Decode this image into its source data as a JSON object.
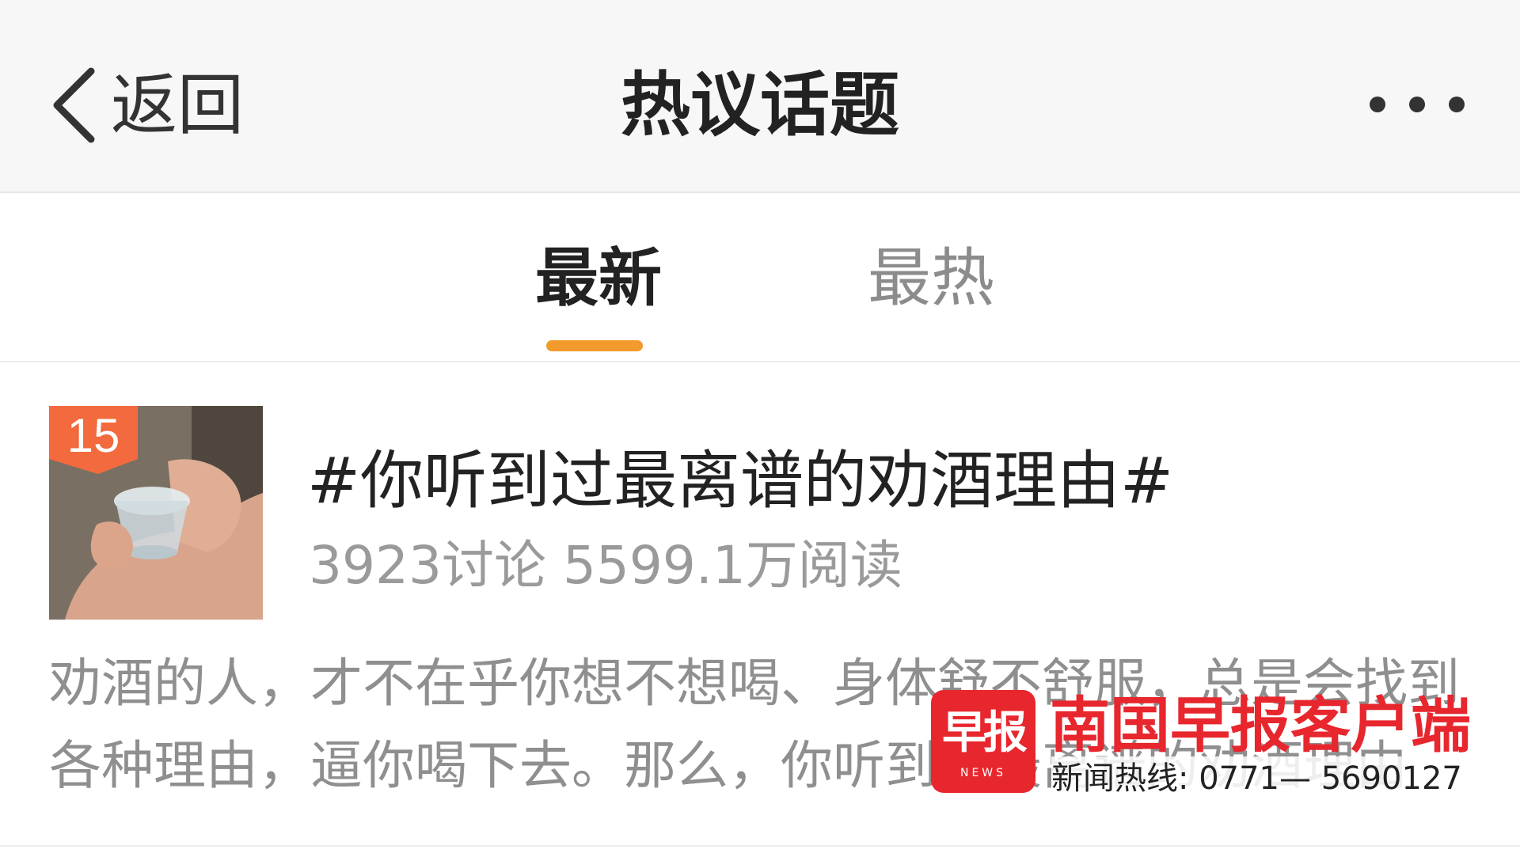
{
  "header": {
    "back_label": "返回",
    "title": "热议话题",
    "back_icon": "chevron-left-icon",
    "more_icon": "more-dots-icon"
  },
  "tabs": [
    {
      "label": "最新",
      "active": true
    },
    {
      "label": "最热",
      "active": false
    }
  ],
  "topic": {
    "rank": "15",
    "title": "#你听到过最离谱的劝酒理由#",
    "stats": "3923讨论 5599.1万阅读",
    "description": "劝酒的人，才不在乎你想不想喝、身体舒不舒服，总是会找到各种理由，逼你喝下去。那么，你听到过最离谱的劝酒理由"
  },
  "watermark": {
    "logo_text": "早报",
    "logo_sub": "NEWS",
    "name": "南国早报客户端",
    "hotline": "新闻热线: 0771— 5690127"
  },
  "colors": {
    "accent": "#f39a2c",
    "badge": "#f26a3d",
    "brand_red": "#e8262d"
  }
}
